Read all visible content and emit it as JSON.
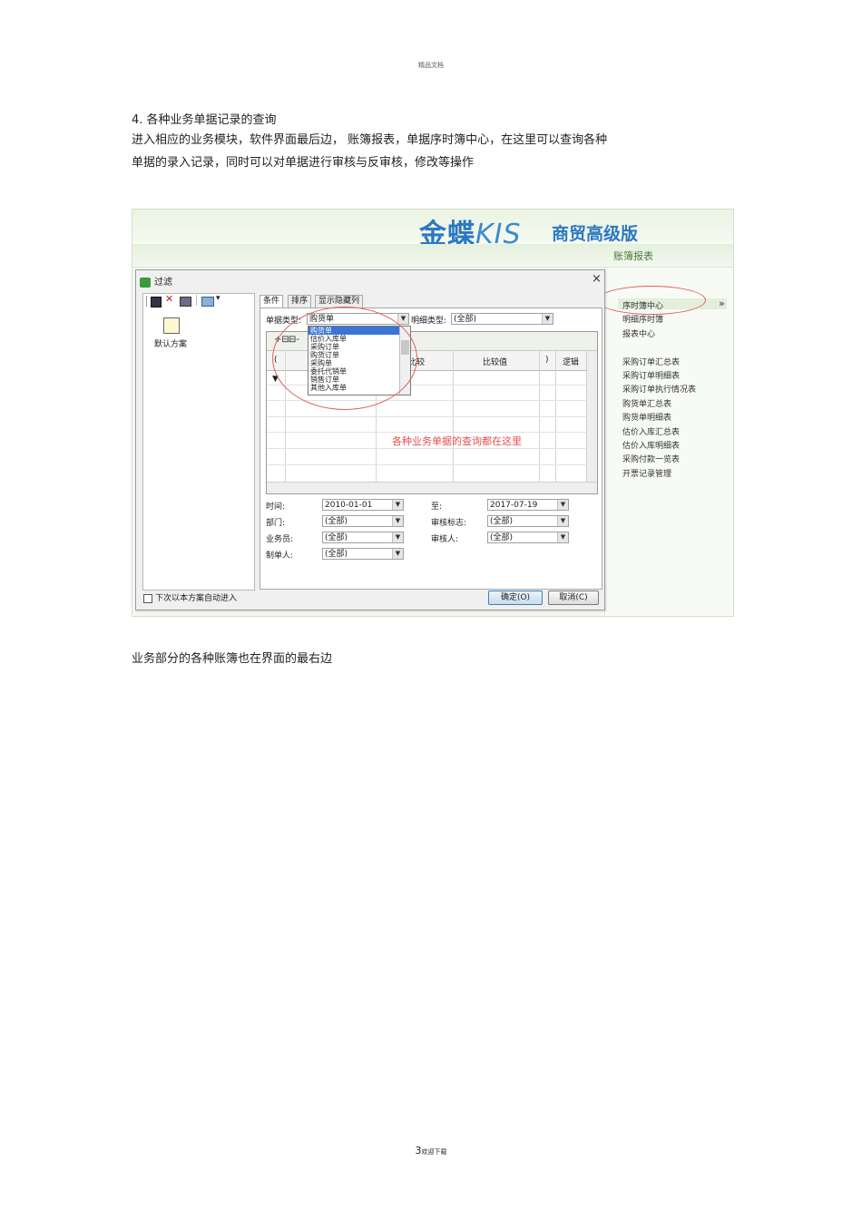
{
  "page": {
    "header": "精品文档",
    "heading": "4. 各种业务单据记录的查询",
    "paragraph1_line1": "进入相应的业务模块，软件界面最后边，          账簿报表，单据序时簿中心，在这里可以查询各种",
    "paragraph1_line2": "单据的录入记录，同时可以对单据进行审核与反审核，修改等操作",
    "paragraph2": "业务部分的各种账簿也在界面的最右边",
    "footer_page": "3",
    "footer_text": "欢迎下载"
  },
  "screenshot": {
    "logo_main": "金蝶",
    "logo_kis": "KIS",
    "logo_edition": "商贸高级版",
    "side_title": "账簿报表",
    "right_menu": [
      "序时簿中心",
      "明细序时簿",
      "报表中心",
      "采购订单汇总表",
      "采购订单明细表",
      "采购订单执行情况表",
      "购货单汇总表",
      "购货单明细表",
      "估价入库汇总表",
      "估价入库明细表",
      "采购付款一览表",
      "开票记录管理"
    ],
    "right_menu_arrow": "»",
    "dialog": {
      "title": "过滤",
      "close": "×",
      "default_scheme": "默认方案",
      "tabs": [
        "条件",
        "排序",
        "显示隐藏列"
      ],
      "doc_type_label": "单据类型:",
      "doc_type_value": "购货单",
      "detail_type_label": "明细类型:",
      "detail_type_value": "(全部)",
      "dropdown_items": [
        "购货单",
        "估价入库单",
        "采购订单",
        "购货订单",
        "采购单",
        "委托代销单",
        "销售订单",
        "其他入库单"
      ],
      "grid_headers": [
        "(",
        "比较",
        "比较值",
        ")",
        "逻辑"
      ],
      "annotation": "各种业务单据的查询都在这里",
      "time_label": "时间:",
      "time_from": "2010-01-01",
      "to_label": "至:",
      "time_to": "2017-07-19",
      "dept_label": "部门:",
      "dept_value": "(全部)",
      "audit_flag_label": "审核标志:",
      "audit_flag_value": "(全部)",
      "salesman_label": "业务员:",
      "salesman_value": "(全部)",
      "auditor_label": "审核人:",
      "auditor_value": "(全部)",
      "creator_label": "制单人:",
      "creator_value": "(全部)",
      "auto_enter_label": "下次以本方案自动进入",
      "ok_button": "确定(O)",
      "cancel_button": "取消(C)"
    }
  }
}
